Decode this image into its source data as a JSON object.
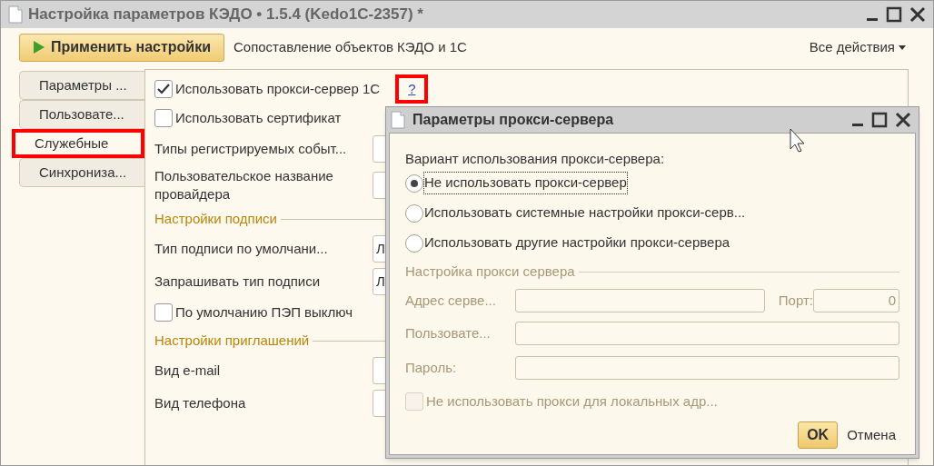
{
  "window": {
    "title": "Настройка параметров КЭДО • 1.5.4 (Kedo1C-2357) *"
  },
  "toolbar": {
    "apply_button": "Применить настройки",
    "link": "Сопоставление объектов КЭДО и 1С",
    "all_actions": "Все действия"
  },
  "tabs": [
    {
      "label": "Параметры ...",
      "selected": false,
      "highlighted": false
    },
    {
      "label": "Пользовате...",
      "selected": false,
      "highlighted": false
    },
    {
      "label": "Служебные",
      "selected": true,
      "highlighted": true
    },
    {
      "label": "Синхрониза...",
      "selected": false,
      "highlighted": false
    }
  ],
  "form": [
    {
      "kind": "checkbox",
      "label": "Использовать прокси-сервер 1С",
      "checked": true,
      "help": {
        "label": "?",
        "highlighted": true
      }
    },
    {
      "kind": "checkbox",
      "label": "Использовать сертификат",
      "checked": false
    },
    {
      "kind": "field",
      "label": "Типы регистрируемых событ..."
    },
    {
      "kind": "field",
      "label": "Пользовательское название провайдера"
    },
    {
      "kind": "group",
      "label": "Настройки подписи"
    },
    {
      "kind": "field",
      "label": "Тип подписи по умолчани...",
      "value": "Л"
    },
    {
      "kind": "field",
      "label": "Запрашивать тип подписи",
      "value": "Л"
    },
    {
      "kind": "checkbox",
      "label": "По умолчанию ПЭП выключ",
      "checked": false
    },
    {
      "kind": "group",
      "label": "Настройки приглашений"
    },
    {
      "kind": "field",
      "label": "Вид e-mail"
    },
    {
      "kind": "field",
      "label": "Вид телефона"
    }
  ],
  "dialog": {
    "title": "Параметры прокси-сервера",
    "prompt": "Вариант использования прокси-сервера:",
    "options": [
      {
        "label": "Не использовать прокси-сервер",
        "selected": true
      },
      {
        "label": "Использовать системные настройки прокси-серв...",
        "selected": false
      },
      {
        "label": "Использовать другие настройки прокси-сервера",
        "selected": false
      }
    ],
    "settings_disabled": true,
    "group": "Настройка прокси сервера",
    "address_label": "Адрес серве...",
    "port_label": "Порт:",
    "port_value": "0",
    "user_label": "Пользовате...",
    "password_label": "Пароль:",
    "local_bypass": {
      "label": "Не использовать прокси для локальных адр...",
      "checked": false
    },
    "ok": "OK",
    "cancel": "Отмена"
  }
}
